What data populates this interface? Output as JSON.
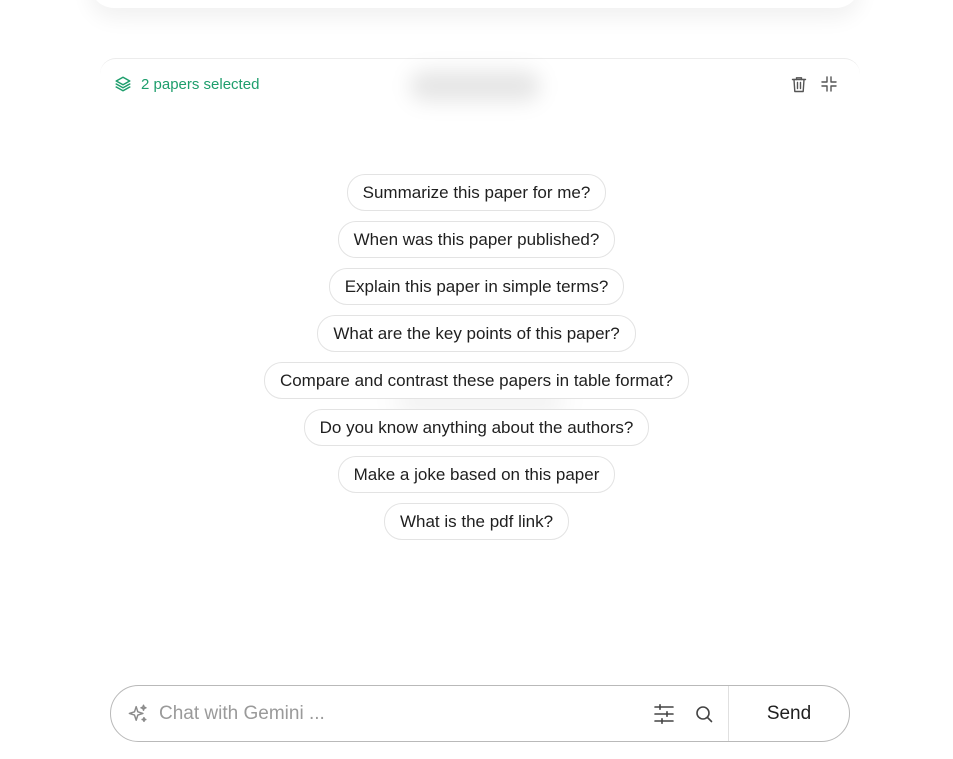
{
  "panel": {
    "selected_label": "2 papers selected",
    "accent_color": "#1e9e6c",
    "icons": {
      "selected": "layers-icon",
      "delete": "trash-icon",
      "collapse": "minimize-icon"
    }
  },
  "suggestions": [
    "Summarize this paper for me?",
    "When was this paper published?",
    "Explain this paper in simple terms?",
    "What are the key points of this paper?",
    "Compare and contrast these papers in table format?",
    "Do you know anything about the authors?",
    "Make a joke based on this paper",
    "What is the pdf link?"
  ],
  "chat": {
    "placeholder": "Chat with Gemini ...",
    "value": "",
    "send_label": "Send",
    "icons": {
      "leading": "sparkle-icon",
      "filter": "sliders-icon",
      "search": "search-icon"
    }
  }
}
